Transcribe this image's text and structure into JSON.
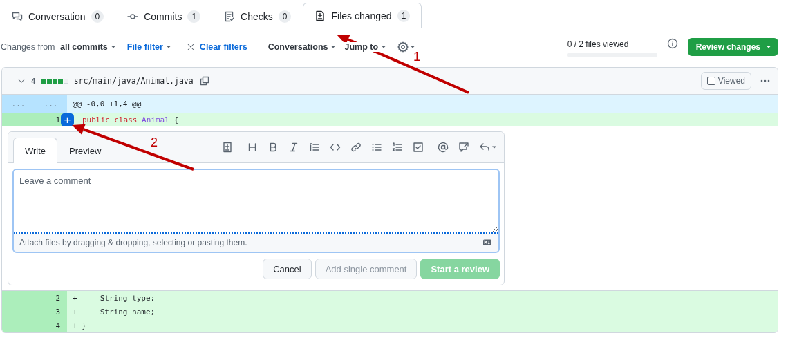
{
  "tabs": [
    {
      "kind": "conversation",
      "label": "Conversation",
      "count": "0",
      "selected": false
    },
    {
      "kind": "commits",
      "label": "Commits",
      "count": "1",
      "selected": false
    },
    {
      "kind": "checks",
      "label": "Checks",
      "count": "0",
      "selected": false
    },
    {
      "kind": "files",
      "label": "Files changed",
      "count": "1",
      "selected": true
    }
  ],
  "toolbar": {
    "items": [
      {
        "kind": "menu",
        "prefix": "Changes from",
        "label": "all commits"
      },
      {
        "kind": "link-menu",
        "label": "File filter"
      },
      {
        "kind": "clear",
        "label": "Clear filters"
      },
      {
        "kind": "menu",
        "label": "Conversations"
      },
      {
        "kind": "menu",
        "label": "Jump to"
      },
      {
        "kind": "settings"
      }
    ],
    "progress": {
      "text": "0 / 2 files viewed",
      "level": 0
    },
    "review_button": "Review changes"
  },
  "file": {
    "expanded": true,
    "changes": "4",
    "diffstat": {
      "level": 0.8
    },
    "path": "src/main/java/Animal.java",
    "viewed": {
      "label": "Viewed",
      "checked": false
    },
    "hunk": {
      "old": "...",
      "new": "...",
      "text": "@@ -0,0 +1,4 @@"
    },
    "lines": [
      {
        "kind": "line",
        "new": "1",
        "add_button": "+",
        "code": [
          {
            "kind": "keyword",
            "text": "public class"
          },
          {
            "kind": "type",
            "text": "Animal"
          },
          {
            "kind": "plain",
            "text": "{"
          }
        ]
      },
      {
        "kind": "comment-form",
        "tabs": [
          {
            "label": "Write",
            "selected": true
          },
          {
            "label": "Preview",
            "selected": false
          }
        ],
        "placeholder": "Leave a comment",
        "hint": "Attach files by dragging & dropping, selecting or pasting them.",
        "buttons": [
          {
            "kind": "default",
            "label": "Cancel",
            "disabled": false
          },
          {
            "kind": "default",
            "label": "Add single comment",
            "disabled": true
          },
          {
            "kind": "primary",
            "label": "Start a review",
            "disabled": true
          }
        ]
      },
      {
        "kind": "line",
        "new": "2",
        "sign": "+",
        "code": [
          {
            "kind": "plain",
            "text": "    String type;"
          }
        ]
      },
      {
        "kind": "line",
        "new": "3",
        "sign": "+",
        "code": [
          {
            "kind": "plain",
            "text": "    String name;"
          }
        ]
      },
      {
        "kind": "line",
        "new": "4",
        "sign": "+",
        "code": [
          {
            "kind": "plain",
            "text": "}"
          }
        ]
      }
    ]
  },
  "annotations": [
    {
      "label": "1"
    },
    {
      "label": "2"
    }
  ]
}
